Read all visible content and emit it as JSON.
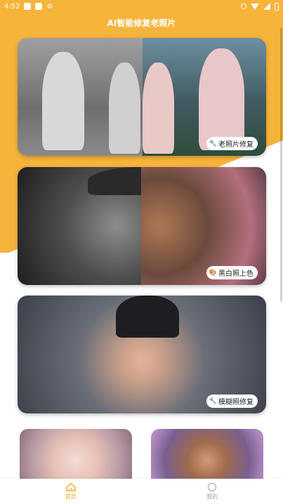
{
  "status_bar": {
    "time": "4:52"
  },
  "page": {
    "title": "AI智能修复老照片"
  },
  "cards": [
    {
      "badge_label": "老照片修复",
      "badge_icon": "🔧"
    },
    {
      "badge_label": "黑白照上色",
      "badge_icon": "🎨"
    },
    {
      "badge_label": "模糊照修复",
      "badge_icon": "🔧"
    }
  ],
  "tabs": [
    {
      "label": "首页",
      "icon": "home-icon",
      "active": true
    },
    {
      "label": "我的",
      "icon": "profile-icon",
      "active": false
    }
  ],
  "colors": {
    "accent": "#f5a623",
    "header_bg": "#f6b43c"
  }
}
